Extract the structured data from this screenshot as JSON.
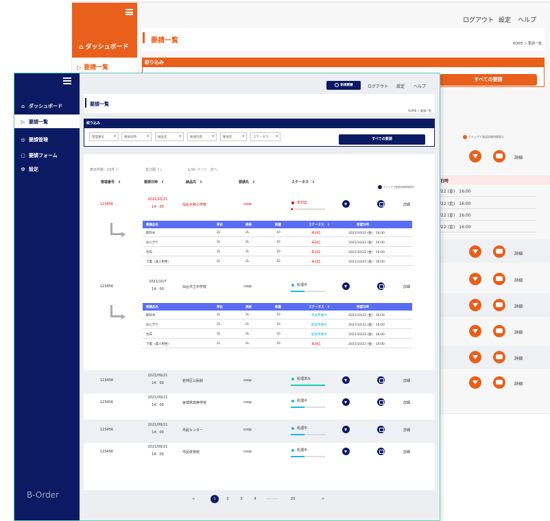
{
  "back": {
    "sidebar": {
      "dashboard": "ダッシュボード",
      "list": "要請一覧"
    },
    "header": {
      "logout": "ログアウト",
      "settings": "設定",
      "help": "ヘルプ"
    },
    "title": "要請一覧",
    "breadcrumb": "HOME > 要請一覧",
    "filter_label": "絞り込み",
    "all_requests": "すべての要請",
    "legend": "クリックで発送詳細時間表示",
    "date_head": "日時",
    "dates": [
      "/22 (金)　16:00",
      "/22 (金)　16:00",
      "/22 (金)　16:00",
      "/22 (金)　16:00"
    ],
    "detail": "詳細"
  },
  "sidebar": {
    "items": [
      {
        "icon": "⌂",
        "label": "ダッシュボード"
      },
      {
        "icon": "▷",
        "label": "要請一覧"
      },
      {
        "icon": "◎",
        "label": "要請管理"
      },
      {
        "icon": "▢",
        "label": "要請フォーム"
      },
      {
        "icon": "✿",
        "label": "設定"
      }
    ],
    "brand": "B-Order"
  },
  "header": {
    "new_request": "新規要請",
    "logout": "ログアウト",
    "settings": "設定",
    "help": "ヘルプ"
  },
  "page": {
    "title": "要請一覧",
    "breadcrumb": "HOME > 要請一覧"
  },
  "filter": {
    "label": "絞り込み",
    "selects": [
      "管理番号",
      "要請日時",
      "納品先",
      "要請内容",
      "要請先",
      "ステータス"
    ],
    "all_button": "すべての要請"
  },
  "list_meta": {
    "count": "表示件数：10件 ▽",
    "sort": "並び順 ↑↓",
    "page": "1/30 ページ　次へ"
  },
  "columns": {
    "id": "管理番号　⇕",
    "date": "要請日時　⇕",
    "dest": "納品先　⇕",
    "to": "要請先　⇕",
    "status": "ステータス　⇕"
  },
  "legend": "クリックで発送詳細時間表示",
  "detail_label": "詳細",
  "sub_columns": {
    "item": "要請品名",
    "unit": "単位",
    "spec": "規格",
    "qty": "数量",
    "status": "ステータス　⇕",
    "hope": "希望日時"
  },
  "rows": [
    {
      "id": "123456",
      "date1": "2021/10/21",
      "date2": "14：00",
      "dest": "仙台大和小学校",
      "to": "coop",
      "status": "未対応",
      "progress": 0.05,
      "red": true,
      "sub": [
        {
          "item": "飲料水",
          "unit": "2L",
          "spec": "2L",
          "qty": "10",
          "status": "未対応",
          "hope": "2021/10/22 (金)　16:00"
        },
        {
          "item": "おにぎり",
          "unit": "2L",
          "spec": "2L",
          "qty": "10",
          "status": "未対応",
          "hope": "2021/10/22 (金)　16:00"
        },
        {
          "item": "毛布",
          "unit": "2L",
          "spec": "2L",
          "qty": "10",
          "status": "未対応",
          "hope": "2021/10/22 (金)　16:00"
        },
        {
          "item": "下着（成人男性）",
          "unit": "2L",
          "spec": "2L",
          "qty": "10",
          "status": "未対応",
          "hope": "2021/10/22 (金)　16:00"
        }
      ]
    },
    {
      "id": "123456",
      "date1": "2021/10/7",
      "date2": "14：00",
      "dest": "仙台市立中学校",
      "to": "coop",
      "status": "処理中",
      "progress": 0.4,
      "red": false,
      "sub": [
        {
          "item": "飲料水",
          "unit": "2L",
          "spec": "2L",
          "qty": "10",
          "status": "商品準備中",
          "hope": "2021/10/22 (金)　16:00"
        },
        {
          "item": "おにぎり",
          "unit": "2L",
          "spec": "2L",
          "qty": "10",
          "status": "配送準備中",
          "hope": "2021/10/22 (金)　16:00"
        },
        {
          "item": "毛布",
          "unit": "2L",
          "spec": "2L",
          "qty": "10",
          "status": "配送準備中",
          "hope": "2021/10/22 (金)　16:00"
        },
        {
          "item": "下着（成人男性）",
          "unit": "2L",
          "spec": "2L",
          "qty": "10",
          "status": "未対応",
          "hope": "2021/10/22 (金)　16:00"
        }
      ]
    },
    {
      "id": "123456",
      "date1": "2021/09/21",
      "date2": "14：00",
      "dest": "若林区公民館",
      "to": "coop",
      "status": "処理済み",
      "progress": 1.0,
      "red": false
    },
    {
      "id": "123456",
      "date1": "2021/09/21",
      "date2": "14：00",
      "dest": "宮城県高等学校",
      "to": "coop",
      "status": "処理中",
      "progress": 0.4,
      "red": false
    },
    {
      "id": "123456",
      "date1": "2021/09/21",
      "date2": "14：00",
      "dest": "市民センター",
      "to": "coop",
      "status": "処理中",
      "progress": 0.4,
      "red": false
    },
    {
      "id": "123456",
      "date1": "2021/09/21",
      "date2": "14：00",
      "dest": "市民体育館",
      "to": "coop",
      "status": "処理中",
      "progress": 0.4,
      "red": false
    }
  ],
  "pagination": {
    "prev": "<",
    "pages": [
      "1",
      "2",
      "3",
      "4"
    ],
    "dots": "· · · · ·",
    "last": "20",
    "next": ">"
  },
  "colors": {
    "navy": "#0c1a63",
    "orange": "#e8601c",
    "red": "#e00000",
    "teal": "#1ec8b0",
    "blue": "#5b6cf4",
    "cyan": "#1bb6e8"
  }
}
